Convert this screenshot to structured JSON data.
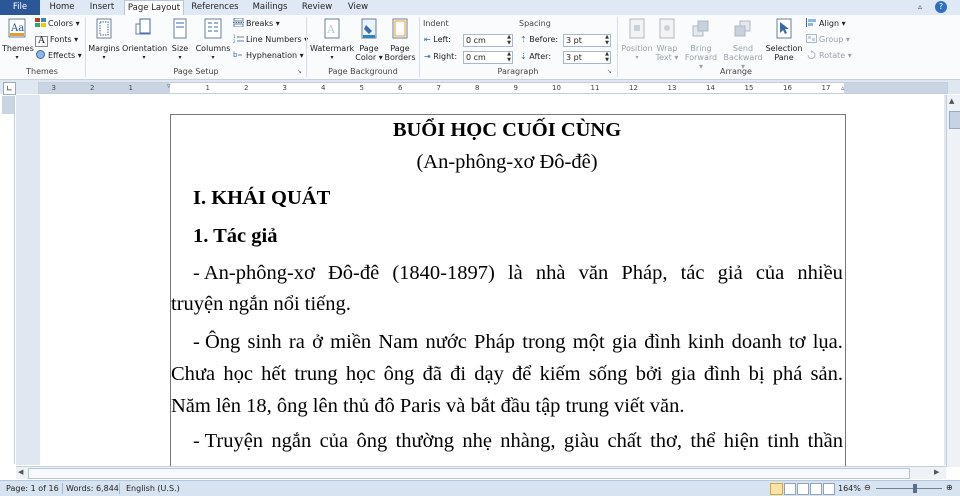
{
  "tabs": {
    "file": "File",
    "home": "Home",
    "insert": "Insert",
    "page_layout": "Page Layout",
    "references": "References",
    "mailings": "Mailings",
    "review": "Review",
    "view": "View"
  },
  "ribbon": {
    "themes": {
      "themes_label": "Themes",
      "colors_label": "Colors",
      "fonts_label": "Fonts",
      "effects_label": "Effects",
      "group_label": "Themes"
    },
    "page_setup": {
      "margins_label": "Margins",
      "orientation_label": "Orientation",
      "size_label": "Size",
      "columns_label": "Columns",
      "breaks_label": "Breaks",
      "line_numbers_label": "Line Numbers",
      "hyphenation_label": "Hyphenation",
      "group_label": "Page Setup"
    },
    "page_background": {
      "watermark_label": "Watermark",
      "page_color_line1": "Page",
      "page_color_line2": "Color",
      "page_borders_line1": "Page",
      "page_borders_line2": "Borders",
      "group_label": "Page Background"
    },
    "paragraph": {
      "indent_title": "Indent",
      "left_label": "Left:",
      "left_value": "0 cm",
      "right_label": "Right:",
      "right_value": "0 cm",
      "spacing_title": "Spacing",
      "before_label": "Before:",
      "before_value": "3 pt",
      "after_label": "After:",
      "after_value": "3 pt",
      "group_label": "Paragraph"
    },
    "arrange": {
      "position_label": "Position",
      "wrap_text_line1": "Wrap",
      "wrap_text_line2": "Text",
      "bring_forward_line1": "Bring",
      "bring_forward_line2": "Forward",
      "send_backward_line1": "Send",
      "send_backward_line2": "Backward",
      "selection_pane_line1": "Selection",
      "selection_pane_line2": "Pane",
      "align_label": "Align",
      "group_btn_label": "Group",
      "rotate_label": "Rotate",
      "group_label": "Arrange"
    }
  },
  "ruler": {
    "ticks": [
      "3",
      "2",
      "1",
      "1",
      "2",
      "3",
      "4",
      "5",
      "6",
      "7",
      "8",
      "9",
      "10",
      "11",
      "12",
      "13",
      "14",
      "15",
      "16",
      "17"
    ]
  },
  "document": {
    "title": "BUỔI HỌC CUỐI CÙNG",
    "author": "(An-phông-xơ Đô-đê)",
    "heading1": "I. KHÁI QUÁT",
    "heading2": "1. Tác giả",
    "para1_line1": [
      "- An-phông-xơ",
      "Đô-đê",
      "(1840-1897)",
      "là",
      "nhà",
      "văn",
      "Pháp,",
      "tác",
      "giả",
      "của",
      "nhiều"
    ],
    "para1_line2": "truyện ngắn nổi tiếng.",
    "para2_line1": [
      "- Ông",
      "sinh",
      "ra",
      "ở",
      "miền",
      "Nam",
      "nước",
      "Pháp",
      "trong",
      "một",
      "gia",
      "đình",
      "kinh",
      "doanh",
      "tơ",
      "lụa."
    ],
    "para2_line2": [
      "Chưa",
      "học",
      "hết",
      "trung",
      "học",
      "ông",
      "đã",
      "đi",
      "dạy",
      "để",
      "kiếm",
      "sống",
      "bởi",
      "gia",
      "đình",
      "bị",
      "phá",
      "sản."
    ],
    "para2_line3": "Năm lên 18, ông lên thủ đô Paris và bắt đầu tập trung viết văn.",
    "para3_line1": [
      "- Truyện",
      "ngắn",
      "của",
      "ông",
      "thường",
      "nhẹ",
      "nhàng,",
      "giàu",
      "chất",
      "thơ,",
      "thể",
      "hiện",
      "tinh",
      "thần"
    ]
  },
  "status": {
    "page": "Page: 1 of 16",
    "words": "Words: 6,844",
    "language": "English (U.S.)",
    "zoom": "164%"
  },
  "colors": {
    "file_tab": "#2b5797",
    "ribbon_bg": "#fafbfd",
    "frame_bg": "#dfe7f1"
  }
}
